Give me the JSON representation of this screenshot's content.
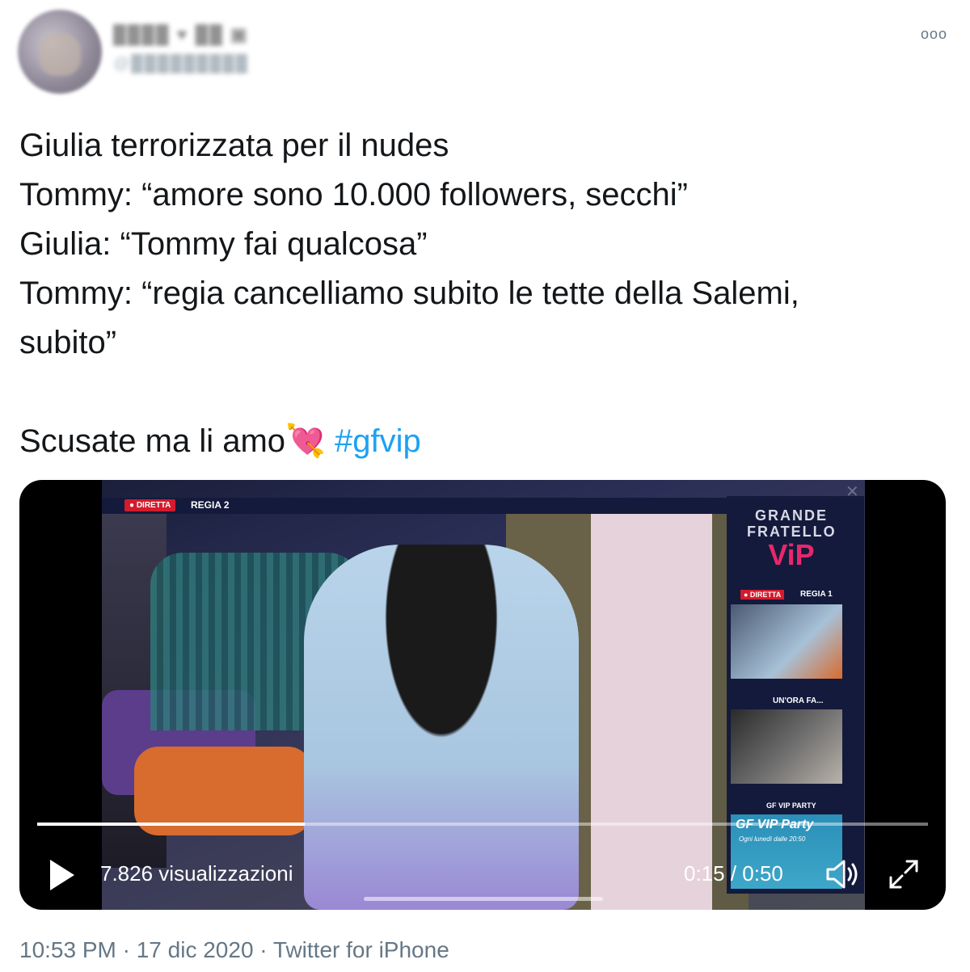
{
  "tweet": {
    "lines": [
      "Giulia terrorizzata per il nudes",
      "Tommy: “amore sono 10.000 followers, secchi”",
      "Giulia: “Tommy fai qualcosa”",
      "Tommy: “regia cancelliamo subito le tette della Salemi,",
      "subito”",
      "",
      "Scusate ma li amo"
    ],
    "emoji": "💘",
    "hashtag": "#gfvip"
  },
  "header": {
    "more_label": "ooo"
  },
  "video": {
    "live_badge": "● DIRETTA",
    "regia_label": "REGIA 2",
    "logo_line1": "GRANDE",
    "logo_line2": "FRATELLO",
    "logo_vip": "ViP",
    "side_live": "● DIRETTA",
    "side_regia": "REGIA 1",
    "side_ora": "UN'ORA FA...",
    "side_party": "GF VIP PARTY",
    "party_title": "GF VIP Party",
    "party_sub": "Ogni lunedì dalle 20:50",
    "views": "7.826 visualizzazioni",
    "time": "0:15 / 0:50",
    "progress": 0.3
  },
  "footer": {
    "text": "10:53 PM · 17 dic 2020 · Twitter for iPhone"
  }
}
